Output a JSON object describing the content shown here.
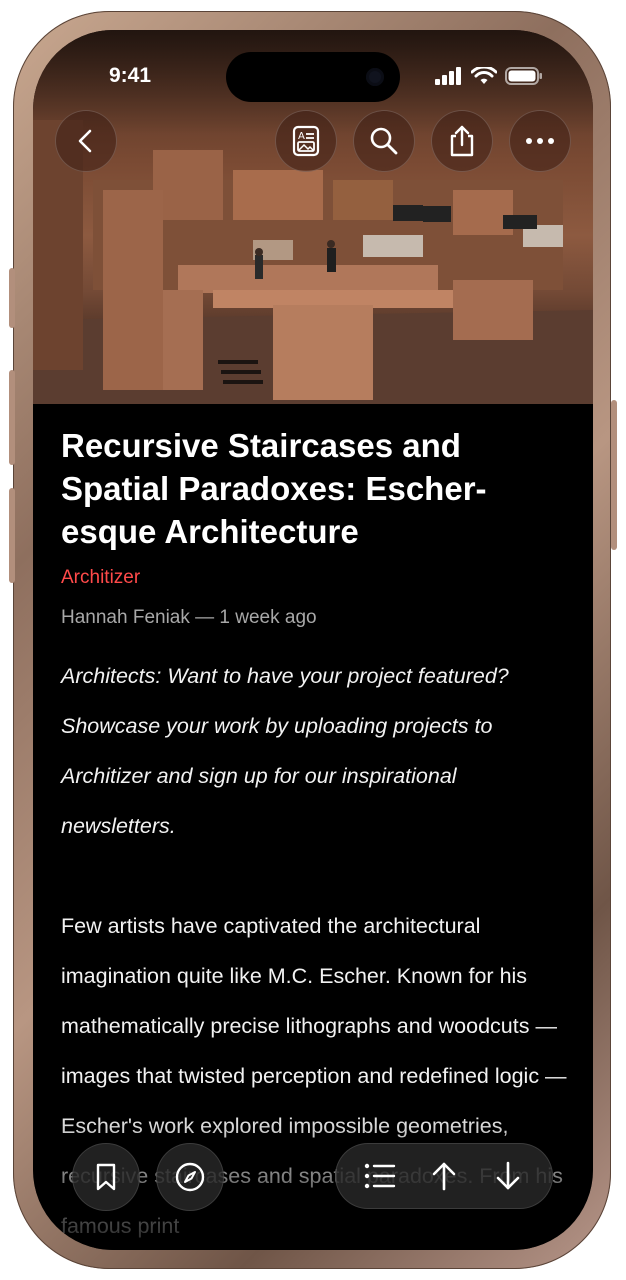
{
  "status_bar": {
    "time": "9:41"
  },
  "nav": {
    "back": "back-icon",
    "actions": [
      "reader-view-icon",
      "search-icon",
      "share-icon",
      "more-icon"
    ]
  },
  "article": {
    "title": "Recursive Staircases and Spatial Paradoxes: Escher-esque Architecture",
    "source": "Architizer",
    "byline": "Hannah Feniak — 1 week ago",
    "intro": "Architects: Want to have your project featured? Showcase your work by uploading projects to Architizer and sign up for our inspirational newsletters.",
    "body": "Few artists have captivated the architectural imagination quite like M.C. Escher. Known for his mathematically precise lithographs and woodcuts — images that twisted perception and redefined logic — Escher's work explored impossible geometries, recursive staircases and spatial paradoxes. From his famous print"
  },
  "toolbar": {
    "left": [
      "bookmark-icon",
      "compass-icon"
    ],
    "right": [
      "list-icon",
      "arrow-up-icon",
      "arrow-down-icon"
    ]
  },
  "colors": {
    "source_accent": "#ff4a4a",
    "background": "#000000",
    "frame": "#b8978a"
  }
}
